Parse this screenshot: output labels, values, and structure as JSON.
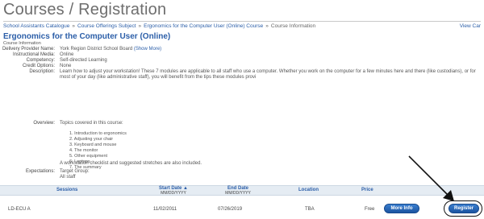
{
  "page_title": "Courses / Registration",
  "breadcrumb": {
    "items": [
      "School Assistants Catalogue",
      "Course Offerings Subject",
      "Ergonomics for the Computer User (Online) Course"
    ],
    "current": "Course Information",
    "view_cart": "View Car"
  },
  "course": {
    "title": "Ergonomics for the Computer User (Online)",
    "info_label": "Course Information",
    "fields": {
      "delivery_provider": {
        "label": "Delivery Provider Name:",
        "value": "York Region District School Board",
        "show_more": "(Show More)"
      },
      "instructional_media": {
        "label": "Instructional Media:",
        "value": "Online"
      },
      "competency": {
        "label": "Competency:",
        "value": "Self-directed Learning"
      },
      "credit_options": {
        "label": "Credit Options:",
        "value": "None"
      },
      "description": {
        "label": "Description:",
        "value": "Learn how to adjust your workstation! These 7 modules are applicable to all staff who use a computer. Whether you work on the computer for a few minutes here and there (like custodians), or for most of your day (like administrative staff), you will benefit from the tips these modules provi"
      },
      "overview": {
        "label": "Overview:",
        "value": "Topics covered in this course:"
      },
      "expectations": {
        "label": "Expectations:",
        "value": "Target Group:",
        "value2": "All staff"
      }
    },
    "topics": [
      "1. Introduction to ergonomics",
      "2. Adjusting your chair",
      "3. Keyboard and mouse",
      "4. The monitor",
      "5. Other equipment",
      "6. Laptops",
      "7. The summary"
    ],
    "checklist_note": "A workstation checklist and suggested stretches are also included."
  },
  "sessions_table": {
    "headers": {
      "sessions": "Sessions",
      "start_date": "Start Date",
      "start_sort_icon": "▲",
      "start_date_format": "MM/DD/YYYY",
      "end_date": "End Date",
      "end_date_format": "MM/DD/YYYY",
      "location": "Location",
      "price": "Price"
    },
    "rows": [
      {
        "session": "LD-ECU A",
        "start": "11/02/2011",
        "end": "07/26/2019",
        "location": "TBA",
        "price": "Free",
        "more_info": "More Info",
        "register": "Register"
      }
    ]
  }
}
